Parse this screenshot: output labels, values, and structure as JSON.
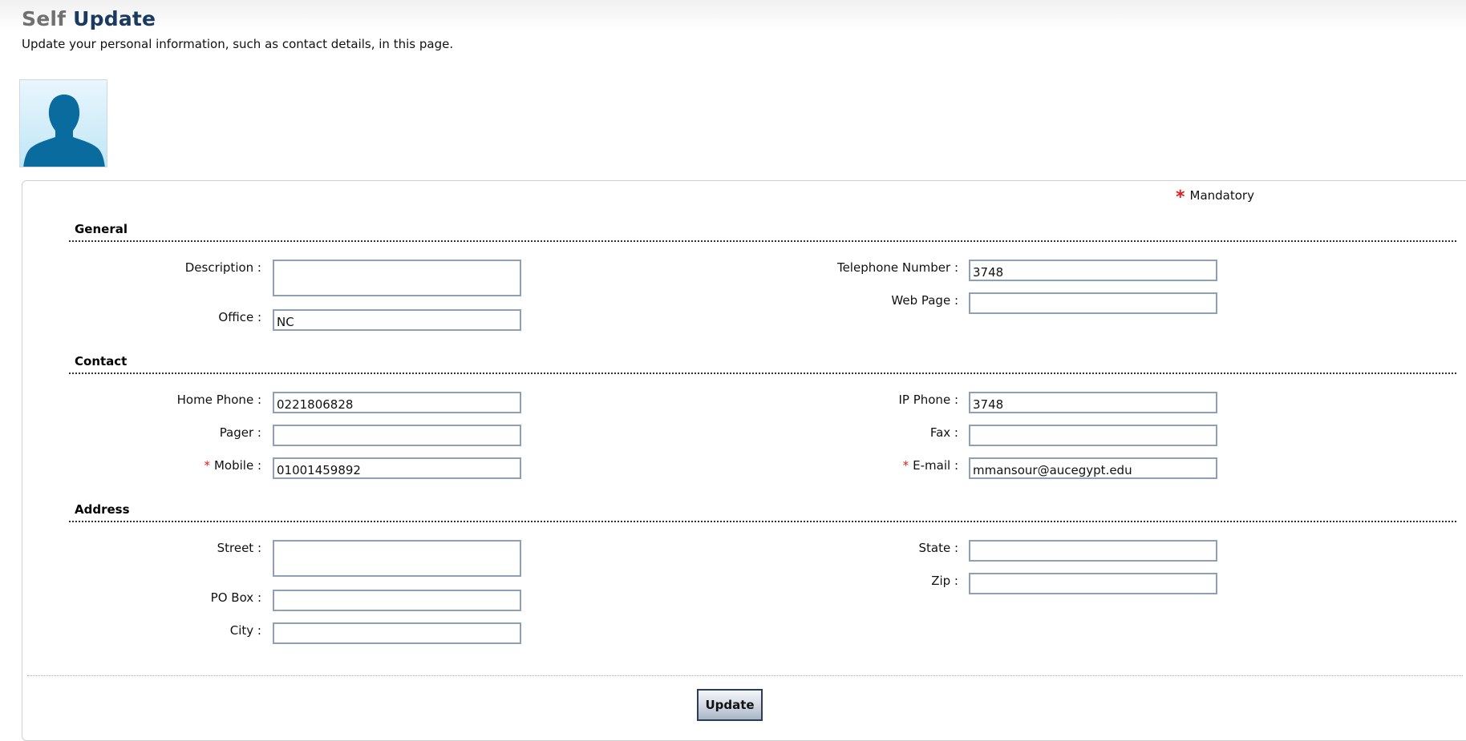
{
  "header": {
    "title_part1": "Self",
    "title_part2": "Update",
    "subtitle": "Update your personal information, such as contact details, in this page."
  },
  "avatar": {
    "icon": "user-silhouette-icon"
  },
  "mandatory_note": {
    "star": "*",
    "label": "Mandatory"
  },
  "sections": {
    "general": {
      "title": "General",
      "description": {
        "label": "Description :",
        "value": ""
      },
      "office": {
        "label": "Office :",
        "value": "NC"
      },
      "telephone_number": {
        "label": "Telephone Number :",
        "value": "3748"
      },
      "web_page": {
        "label": "Web Page :",
        "value": ""
      }
    },
    "contact": {
      "title": "Contact",
      "home_phone": {
        "label": "Home Phone :",
        "value": "0221806828"
      },
      "pager": {
        "label": "Pager :",
        "value": ""
      },
      "mobile": {
        "label": "Mobile :",
        "required_marker": "*",
        "value": "01001459892"
      },
      "ip_phone": {
        "label": "IP Phone :",
        "value": "3748"
      },
      "fax": {
        "label": "Fax :",
        "value": ""
      },
      "email": {
        "label": "E-mail :",
        "required_marker": "*",
        "value": "mmansour@aucegypt.edu"
      }
    },
    "address": {
      "title": "Address",
      "street": {
        "label": "Street :",
        "value": ""
      },
      "po_box": {
        "label": "PO Box :",
        "value": ""
      },
      "city": {
        "label": "City :",
        "value": ""
      },
      "state": {
        "label": "State :",
        "value": ""
      },
      "zip": {
        "label": "Zip :",
        "value": ""
      }
    }
  },
  "actions": {
    "update_label": "Update"
  },
  "colors": {
    "title_gray": "#707070",
    "title_navy": "#1b3a60",
    "required_red": "#e11d1d",
    "field_border": "#8da0b6"
  }
}
